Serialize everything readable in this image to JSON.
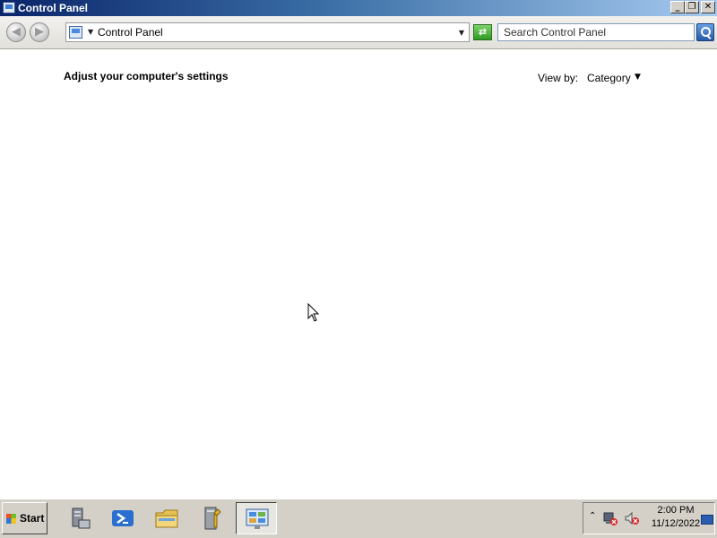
{
  "window": {
    "title": "Control Panel",
    "buttons": {
      "minimize": "_",
      "maximize": "❐",
      "close": "✕"
    }
  },
  "navigation": {
    "back_icon": "back-arrow-icon",
    "forward_icon": "forward-arrow-icon",
    "address": {
      "crumb": "Control Panel"
    },
    "search": {
      "placeholder": "Search Control Panel"
    }
  },
  "content": {
    "heading": "Adjust your computer's settings",
    "view_by": {
      "label": "View by:",
      "value": "Category"
    }
  },
  "taskbar": {
    "start_label": "Start",
    "pinned": [
      "server-manager-icon",
      "powershell-icon",
      "file-explorer-icon",
      "administrative-tools-icon",
      "control-panel-icon"
    ],
    "active": "control-panel-icon",
    "tray": {
      "time": "2:00 PM",
      "date": "11/12/2022"
    }
  },
  "colors": {
    "titlebar_start": "#0a246a",
    "titlebar_end": "#a6caf0",
    "taskbar": "#d4d0c8",
    "refresh_green": "#2e9a22"
  }
}
